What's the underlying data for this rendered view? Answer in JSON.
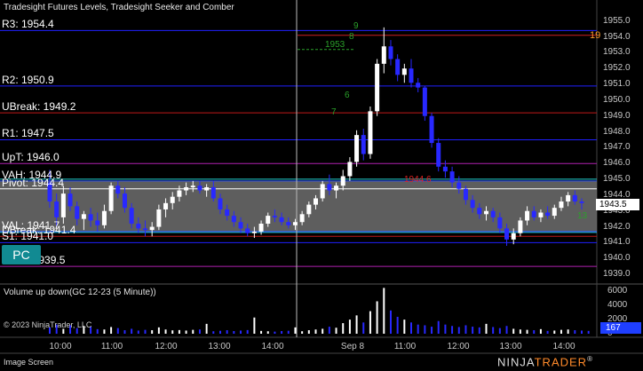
{
  "title": "Tradesight Futures Levels, Tradesight Seeker and Comber",
  "levels": [
    {
      "label": "R3: 1954.4",
      "price": 1954.4,
      "color": "#2020ff"
    },
    {
      "label": "R2: 1950.9",
      "price": 1950.9,
      "color": "#2020ff"
    },
    {
      "label": "UBreak: 1949.2",
      "price": 1949.2,
      "color": "#c01818"
    },
    {
      "label": "R1: 1947.5",
      "price": 1947.5,
      "color": "#2020ff"
    },
    {
      "label": "UpT: 1946.0",
      "price": 1946.0,
      "color": "#b020b0"
    },
    {
      "label": "VAH: 1944.9",
      "price": 1944.9,
      "color": "#3050ff"
    },
    {
      "label": "Pivot: 1944.4",
      "price": 1944.4,
      "color": "#ffffff"
    },
    {
      "label": "VAL: 1941.7",
      "price": 1941.7,
      "color": "#3050ff"
    },
    {
      "label": "DBreak: 1941.4",
      "price": 1941.4,
      "color": "#c01818"
    },
    {
      "label": "S1: 1941.0",
      "price": 1941.0,
      "color": "#2020ff"
    },
    {
      "label": "LowT: 1939.5",
      "price": 1939.5,
      "color": "#b020b0"
    }
  ],
  "annotations": {
    "seeker_top": "8",
    "seeker_9": "9",
    "comber_1953": "1953",
    "comber_6": "6",
    "comber_7": "7",
    "red_label": "1944.6",
    "green_bottom": "13"
  },
  "pc_button": "PC",
  "current_price": "1943.5",
  "orange_tag": "19",
  "volume_title": "Volume up down(GC 12-23 (5 Minute))",
  "volume_value": "167",
  "copyright": "© 2023 NinjaTrader, LLC",
  "footer_label": "Image Screen",
  "logo_ninja": "NINJA",
  "logo_trader": "TRADER",
  "logo_suffix": "®",
  "price_axis": [
    "1955.0",
    "1954.0",
    "1953.0",
    "1952.0",
    "1951.0",
    "1950.0",
    "1949.0",
    "1948.0",
    "1947.0",
    "1946.0",
    "1945.0",
    "1944.0",
    "1943.0",
    "1942.0",
    "1941.0",
    "1940.0",
    "1939.0"
  ],
  "volume_axis": [
    "6000",
    "4000",
    "2000",
    "0"
  ],
  "time_axis": [
    "10:00",
    "11:00",
    "12:00",
    "13:00",
    "14:00",
    "Sep 8",
    "11:00",
    "12:00",
    "13:00",
    "14:00"
  ],
  "colors": {
    "up": "#ffffff",
    "down": "#2828ff",
    "value_area": "#6e6e6e",
    "value_area_edge": "#22d0d0",
    "seeker": "#2aa02a",
    "annot_red": "#e02020"
  },
  "chart_data": {
    "type": "candlestick",
    "instrument": "GC 12-23 (5 Minute)",
    "ylim": [
      1938.5,
      1955.6
    ],
    "ohlc": [
      {
        "o": 1944.8,
        "h": 1945.6,
        "l": 1943.2,
        "c": 1943.6
      },
      {
        "o": 1943.6,
        "h": 1944.1,
        "l": 1942.0,
        "c": 1942.6
      },
      {
        "o": 1942.6,
        "h": 1944.6,
        "l": 1942.2,
        "c": 1944.1
      },
      {
        "o": 1944.1,
        "h": 1944.5,
        "l": 1943.0,
        "c": 1943.3
      },
      {
        "o": 1943.3,
        "h": 1943.6,
        "l": 1942.1,
        "c": 1942.5
      },
      {
        "o": 1942.5,
        "h": 1943.0,
        "l": 1941.8,
        "c": 1942.8
      },
      {
        "o": 1942.8,
        "h": 1943.2,
        "l": 1942.0,
        "c": 1942.4
      },
      {
        "o": 1942.4,
        "h": 1942.9,
        "l": 1941.7,
        "c": 1942.1
      },
      {
        "o": 1942.1,
        "h": 1943.4,
        "l": 1941.9,
        "c": 1943.0
      },
      {
        "o": 1943.0,
        "h": 1944.8,
        "l": 1942.8,
        "c": 1944.6
      },
      {
        "o": 1944.6,
        "h": 1944.9,
        "l": 1943.8,
        "c": 1944.1
      },
      {
        "o": 1944.1,
        "h": 1944.5,
        "l": 1942.9,
        "c": 1943.2
      },
      {
        "o": 1943.2,
        "h": 1943.5,
        "l": 1941.9,
        "c": 1942.2
      },
      {
        "o": 1942.2,
        "h": 1942.6,
        "l": 1941.6,
        "c": 1941.9
      },
      {
        "o": 1941.9,
        "h": 1942.4,
        "l": 1941.4,
        "c": 1941.8
      },
      {
        "o": 1941.8,
        "h": 1942.3,
        "l": 1941.4,
        "c": 1942.0
      },
      {
        "o": 1942.0,
        "h": 1943.4,
        "l": 1941.8,
        "c": 1943.1
      },
      {
        "o": 1943.1,
        "h": 1943.8,
        "l": 1942.6,
        "c": 1943.5
      },
      {
        "o": 1943.5,
        "h": 1944.2,
        "l": 1943.1,
        "c": 1943.9
      },
      {
        "o": 1943.9,
        "h": 1944.6,
        "l": 1943.6,
        "c": 1944.3
      },
      {
        "o": 1944.3,
        "h": 1944.8,
        "l": 1944.0,
        "c": 1944.5
      },
      {
        "o": 1944.5,
        "h": 1944.9,
        "l": 1944.2,
        "c": 1944.6
      },
      {
        "o": 1944.6,
        "h": 1944.9,
        "l": 1944.1,
        "c": 1944.3
      },
      {
        "o": 1944.3,
        "h": 1944.7,
        "l": 1943.9,
        "c": 1944.5
      },
      {
        "o": 1944.5,
        "h": 1944.9,
        "l": 1943.6,
        "c": 1943.8
      },
      {
        "o": 1943.8,
        "h": 1944.1,
        "l": 1942.8,
        "c": 1943.1
      },
      {
        "o": 1943.1,
        "h": 1943.4,
        "l": 1942.4,
        "c": 1942.7
      },
      {
        "o": 1942.7,
        "h": 1943.0,
        "l": 1942.0,
        "c": 1942.3
      },
      {
        "o": 1942.3,
        "h": 1942.6,
        "l": 1941.6,
        "c": 1941.9
      },
      {
        "o": 1941.9,
        "h": 1942.2,
        "l": 1941.4,
        "c": 1941.6
      },
      {
        "o": 1941.6,
        "h": 1942.0,
        "l": 1941.3,
        "c": 1941.7
      },
      {
        "o": 1941.7,
        "h": 1942.4,
        "l": 1941.5,
        "c": 1942.2
      },
      {
        "o": 1942.2,
        "h": 1942.9,
        "l": 1942.0,
        "c": 1942.7
      },
      {
        "o": 1942.7,
        "h": 1943.1,
        "l": 1942.3,
        "c": 1942.6
      },
      {
        "o": 1942.6,
        "h": 1942.9,
        "l": 1942.1,
        "c": 1942.3
      },
      {
        "o": 1942.3,
        "h": 1942.6,
        "l": 1941.9,
        "c": 1942.1
      },
      {
        "o": 1942.1,
        "h": 1942.5,
        "l": 1941.8,
        "c": 1942.3
      },
      {
        "o": 1942.3,
        "h": 1943.0,
        "l": 1942.1,
        "c": 1942.8
      },
      {
        "o": 1942.8,
        "h": 1943.6,
        "l": 1942.6,
        "c": 1943.4
      },
      {
        "o": 1943.4,
        "h": 1944.0,
        "l": 1943.1,
        "c": 1943.8
      },
      {
        "o": 1943.8,
        "h": 1944.9,
        "l": 1943.6,
        "c": 1944.7
      },
      {
        "o": 1944.7,
        "h": 1945.3,
        "l": 1944.0,
        "c": 1944.3
      },
      {
        "o": 1944.3,
        "h": 1944.8,
        "l": 1943.8,
        "c": 1944.6
      },
      {
        "o": 1944.6,
        "h": 1945.6,
        "l": 1944.3,
        "c": 1945.2
      },
      {
        "o": 1945.2,
        "h": 1946.4,
        "l": 1944.9,
        "c": 1946.1
      },
      {
        "o": 1946.1,
        "h": 1948.1,
        "l": 1945.8,
        "c": 1947.8
      },
      {
        "o": 1947.8,
        "h": 1948.2,
        "l": 1946.2,
        "c": 1946.6
      },
      {
        "o": 1946.6,
        "h": 1949.6,
        "l": 1946.3,
        "c": 1949.3
      },
      {
        "o": 1949.3,
        "h": 1952.6,
        "l": 1949.0,
        "c": 1952.3
      },
      {
        "o": 1952.3,
        "h": 1954.6,
        "l": 1951.7,
        "c": 1953.4
      },
      {
        "o": 1953.4,
        "h": 1953.8,
        "l": 1952.2,
        "c": 1952.6
      },
      {
        "o": 1952.6,
        "h": 1952.9,
        "l": 1951.2,
        "c": 1951.6
      },
      {
        "o": 1951.6,
        "h": 1952.3,
        "l": 1951.1,
        "c": 1952.0
      },
      {
        "o": 1952.0,
        "h": 1952.6,
        "l": 1950.8,
        "c": 1951.1
      },
      {
        "o": 1951.1,
        "h": 1951.4,
        "l": 1950.5,
        "c": 1950.8
      },
      {
        "o": 1950.8,
        "h": 1950.9,
        "l": 1948.7,
        "c": 1949.0
      },
      {
        "o": 1949.0,
        "h": 1949.2,
        "l": 1947.0,
        "c": 1947.3
      },
      {
        "o": 1947.3,
        "h": 1947.6,
        "l": 1945.5,
        "c": 1945.8
      },
      {
        "o": 1945.8,
        "h": 1946.2,
        "l": 1945.1,
        "c": 1945.5
      },
      {
        "o": 1945.5,
        "h": 1945.8,
        "l": 1944.5,
        "c": 1944.8
      },
      {
        "o": 1944.8,
        "h": 1945.2,
        "l": 1944.1,
        "c": 1944.4
      },
      {
        "o": 1944.4,
        "h": 1944.6,
        "l": 1943.4,
        "c": 1943.7
      },
      {
        "o": 1943.7,
        "h": 1944.0,
        "l": 1942.9,
        "c": 1943.2
      },
      {
        "o": 1943.2,
        "h": 1943.5,
        "l": 1942.5,
        "c": 1942.8
      },
      {
        "o": 1942.8,
        "h": 1943.3,
        "l": 1942.4,
        "c": 1943.0
      },
      {
        "o": 1943.0,
        "h": 1943.2,
        "l": 1942.3,
        "c": 1942.6
      },
      {
        "o": 1942.6,
        "h": 1942.9,
        "l": 1941.6,
        "c": 1941.9
      },
      {
        "o": 1941.9,
        "h": 1942.2,
        "l": 1940.8,
        "c": 1941.2
      },
      {
        "o": 1941.2,
        "h": 1941.9,
        "l": 1940.9,
        "c": 1941.6
      },
      {
        "o": 1941.6,
        "h": 1942.6,
        "l": 1941.4,
        "c": 1942.4
      },
      {
        "o": 1942.4,
        "h": 1943.3,
        "l": 1942.1,
        "c": 1943.0
      },
      {
        "o": 1943.0,
        "h": 1943.3,
        "l": 1942.4,
        "c": 1942.6
      },
      {
        "o": 1942.6,
        "h": 1943.1,
        "l": 1942.3,
        "c": 1942.9
      },
      {
        "o": 1942.9,
        "h": 1943.3,
        "l": 1942.5,
        "c": 1942.7
      },
      {
        "o": 1942.7,
        "h": 1943.4,
        "l": 1942.5,
        "c": 1943.2
      },
      {
        "o": 1943.2,
        "h": 1943.9,
        "l": 1943.0,
        "c": 1943.6
      },
      {
        "o": 1943.6,
        "h": 1944.2,
        "l": 1943.3,
        "c": 1944.0
      },
      {
        "o": 1944.0,
        "h": 1944.3,
        "l": 1943.4,
        "c": 1943.6
      },
      {
        "o": 1943.6,
        "h": 1943.8,
        "l": 1943.1,
        "c": 1943.5
      }
    ],
    "volume": [
      900,
      1300,
      700,
      1200,
      800,
      1100,
      1000,
      650,
      600,
      950,
      800,
      500,
      700,
      450,
      550,
      500,
      900,
      600,
      480,
      520,
      450,
      550,
      600,
      1400,
      350,
      420,
      500,
      380,
      450,
      520,
      2300,
      400,
      350,
      300,
      380,
      420,
      900,
      350,
      500,
      600,
      700,
      1000,
      850,
      1500,
      2000,
      2600,
      1600,
      3200,
      4600,
      6500,
      3300,
      2400,
      2000,
      1600,
      1300,
      1200,
      1000,
      1800,
      1300,
      1100,
      950,
      1200,
      1000,
      900,
      1400,
      950,
      800,
      1100,
      700,
      600,
      550,
      500,
      650,
      400,
      450,
      550,
      600,
      500,
      450,
      400
    ]
  }
}
